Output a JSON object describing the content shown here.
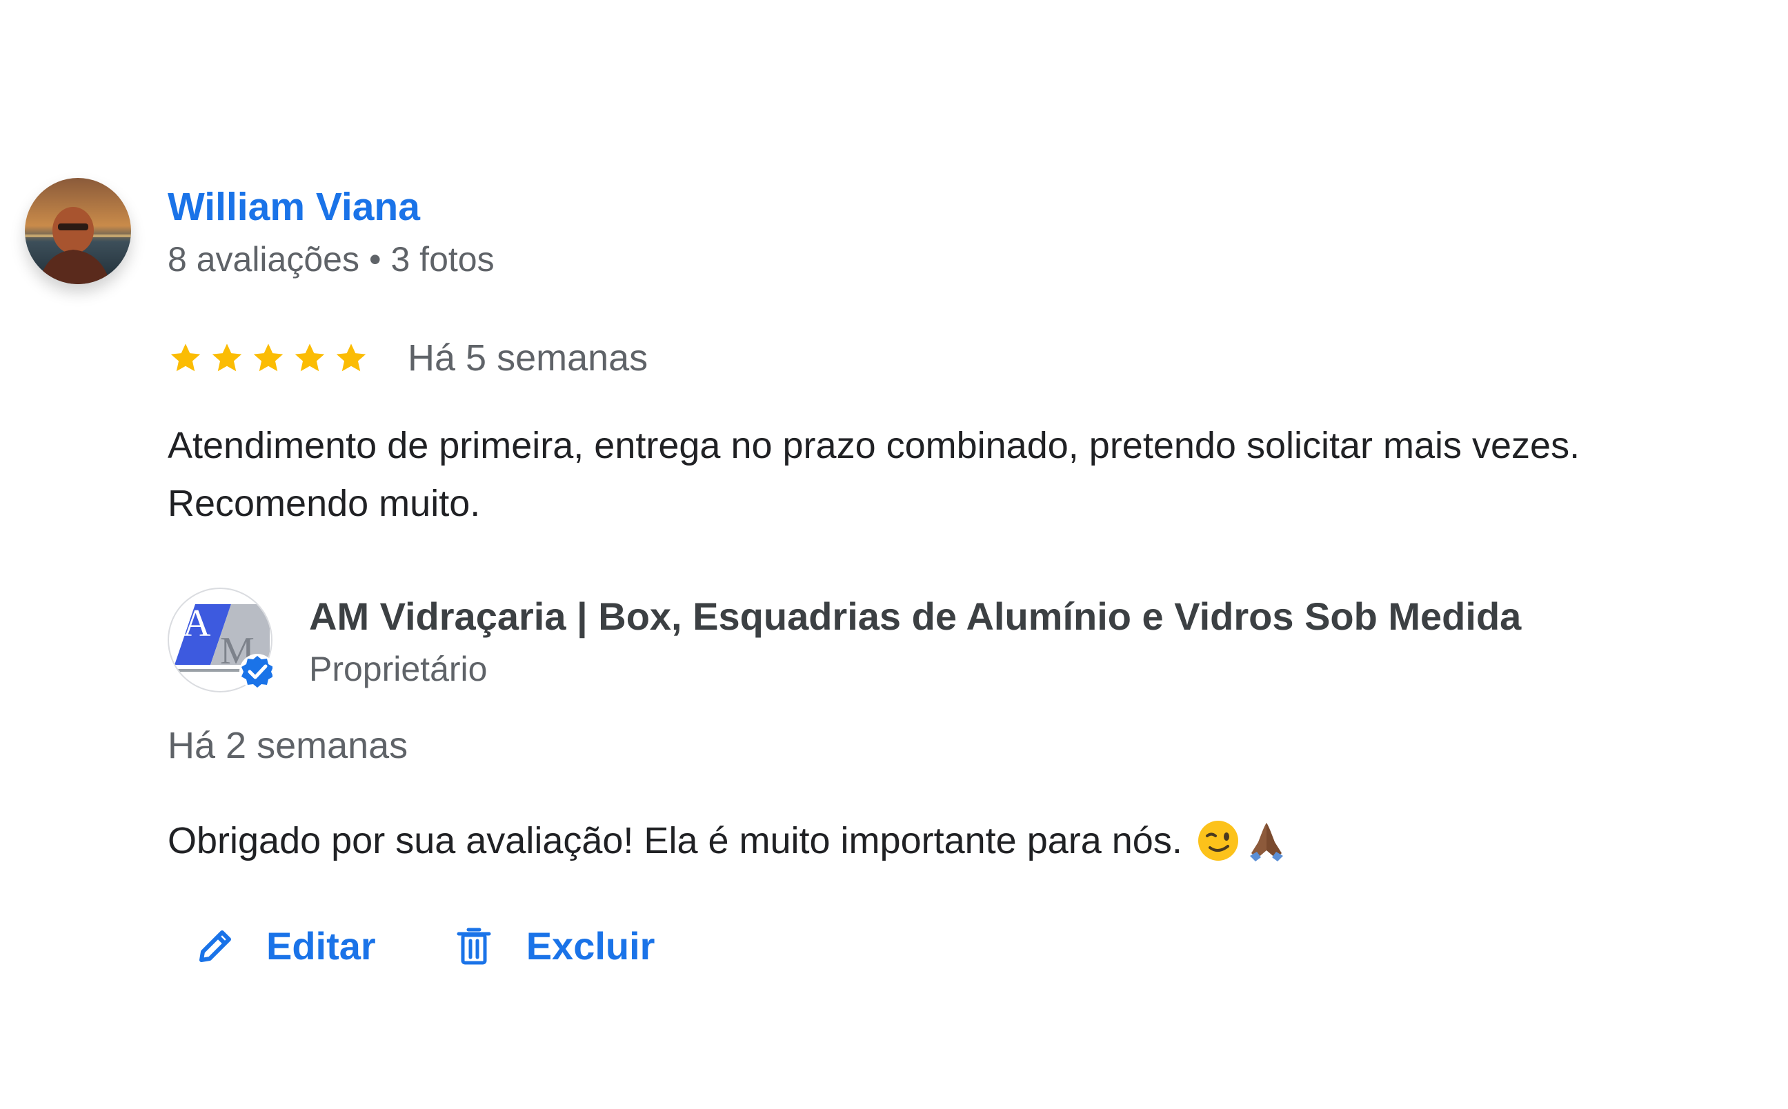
{
  "review": {
    "reviewer_name": "William Viana",
    "reviewer_meta_reviews": "8 avaliações",
    "reviewer_meta_separator": "•",
    "reviewer_meta_photos": "3 fotos",
    "rating": 5,
    "rating_max": 5,
    "date": "Há 5 semanas",
    "text": "Atendimento de primeira, entrega no prazo combinado, pretendo solicitar mais vezes. Recomendo muito."
  },
  "reply": {
    "owner_name": "AM Vidraçaria | Box, Esquadrias de Alumínio e Vidros Sob Medida",
    "owner_role": "Proprietário",
    "date": "Há 2 semanas",
    "text": "Obrigado por sua avaliação! Ela é muito importante para nós.",
    "emojis": [
      "winking-face-emoji",
      "folded-hands-emoji"
    ]
  },
  "actions": {
    "edit_label": "Editar",
    "delete_label": "Excluir"
  },
  "colors": {
    "link_blue": "#1a73e8",
    "star_gold": "#fbbc04",
    "text_primary": "#202124",
    "text_secondary": "#5f6368",
    "verified_blue": "#1a73e8"
  }
}
